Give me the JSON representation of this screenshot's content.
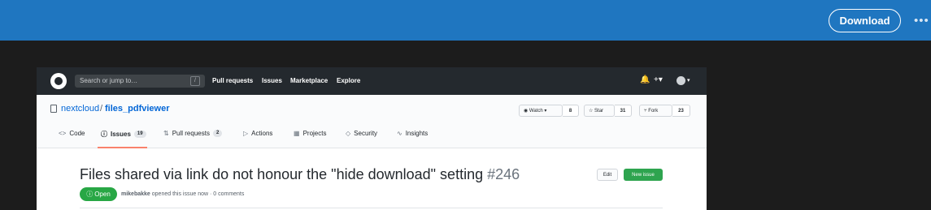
{
  "viewer": {
    "download_label": "Download",
    "more_label": "•••"
  },
  "github": {
    "search_placeholder": "Search or jump to…",
    "search_shortcut": "/",
    "nav": [
      "Pull requests",
      "Issues",
      "Marketplace",
      "Explore"
    ],
    "header_icons": {
      "bell": "🔔",
      "plus": "+▾",
      "avatar_caret": "▾"
    }
  },
  "repo": {
    "owner": "nextcloud",
    "separator": "/",
    "name": "files_pdfviewer",
    "watch_label": "Watch ▾",
    "watch_count": "8",
    "star_label": "Star",
    "star_count": "31",
    "fork_label": "Fork",
    "fork_count": "23"
  },
  "tabs": [
    {
      "label": "Code",
      "icon": "<>"
    },
    {
      "label": "Issues",
      "icon": "ⓘ",
      "count": "19"
    },
    {
      "label": "Pull requests",
      "icon": "⇅",
      "count": "2"
    },
    {
      "label": "Actions",
      "icon": "▷"
    },
    {
      "label": "Projects",
      "icon": "▦"
    },
    {
      "label": "Security",
      "icon": "◇"
    },
    {
      "label": "Insights",
      "icon": "∿"
    }
  ],
  "issue": {
    "title": "Files shared via link do not honour the \"hide download\" setting",
    "number": "#246",
    "edit_label": "Edit",
    "new_issue_label": "New issue",
    "state": "Open",
    "author": "mikebakke",
    "meta_rest": "opened this issue now · 0 comments"
  },
  "colors": {
    "topbar": "#1f76c0",
    "gh_header": "#24292e",
    "link": "#0366d6",
    "open_green": "#28a745",
    "tab_underline": "#f9826c"
  }
}
